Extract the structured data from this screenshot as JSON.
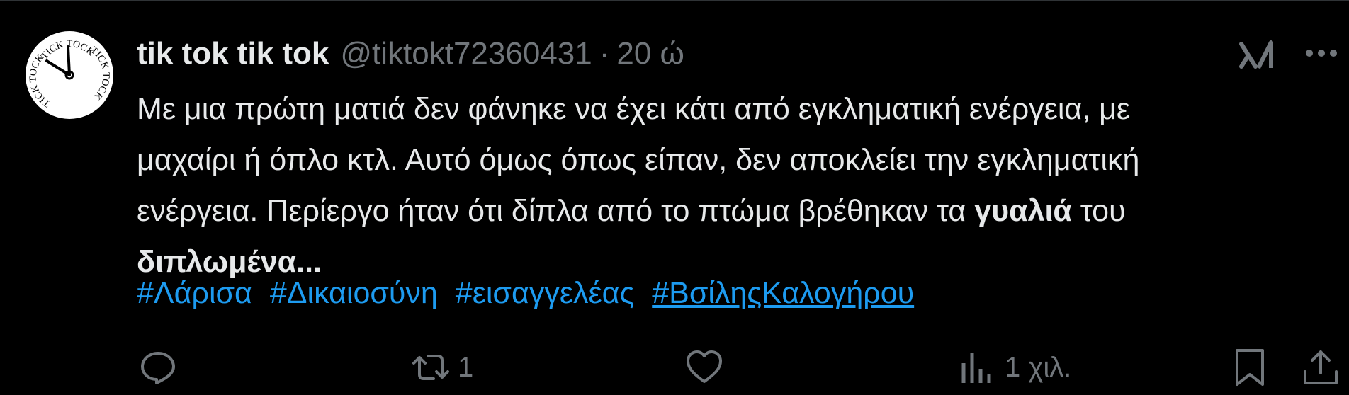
{
  "tweet": {
    "display_name": "tik tok tik tok",
    "handle": "@tiktokt72360431",
    "separator": "·",
    "time": "20 ώ",
    "avatar_text_top": "TICK TOCK",
    "avatar_text_right": "TICK TOCK",
    "avatar_text_left": "TICK TOCK",
    "body": {
      "line1": "Με μια πρώτη ματιά δεν φάνηκε να έχει κάτι από εγκληματική ενέργεια, με",
      "line2": "μαχαίρι ή όπλο κτλ. Αυτό όμως όπως είπαν, δεν αποκλείει την εγκληματική",
      "line3_a": "ενέργεια. Περίεργο ήταν ότι δίπλα από το πτώμα βρέθηκαν τα ",
      "line3_bold": "γυαλιά",
      "line3_b": " του",
      "line4_bold": "διπλωμένα..."
    },
    "hashtags": [
      "#Λάρισα",
      "#Δικαιοσύνη",
      "#εισαγγελέας",
      "#ΒσίληςΚαλογήρου"
    ],
    "actions": {
      "reply_count": "",
      "retweet_count": "1",
      "like_count": "",
      "views_count": "1 χιλ."
    }
  },
  "icons": {
    "grok": "grok-icon",
    "more": "more-icon",
    "reply": "reply-icon",
    "retweet": "retweet-icon",
    "like": "heart-icon",
    "views": "views-icon",
    "bookmark": "bookmark-icon",
    "share": "share-icon"
  },
  "colors": {
    "background": "#000000",
    "text": "#e7e9ea",
    "muted": "#71767b",
    "link": "#1d9bf0"
  }
}
